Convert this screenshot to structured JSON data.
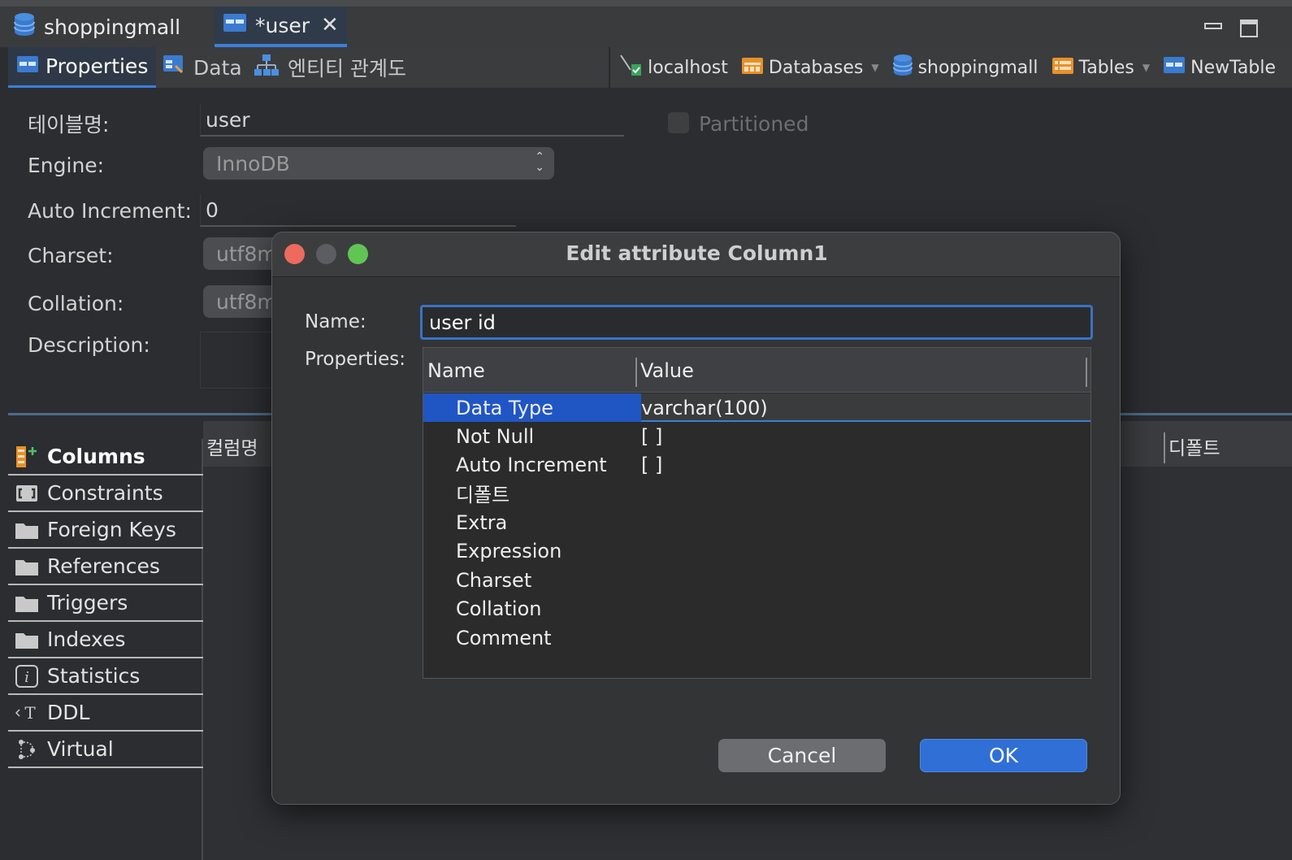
{
  "editor_tabs": [
    {
      "label": "shoppingmall",
      "icon": "database-icon"
    },
    {
      "label": "*user",
      "icon": "table-icon",
      "active": true
    }
  ],
  "sub_tabs": [
    {
      "label": "Properties",
      "icon": "table-icon",
      "active": true
    },
    {
      "label": "Data",
      "icon": "data-icon"
    },
    {
      "label": "엔티티 관계도",
      "icon": "diagram-icon"
    }
  ],
  "breadcrumbs": [
    {
      "label": "localhost",
      "icon": "connection-icon"
    },
    {
      "label": "Databases",
      "icon": "folder-icon",
      "dropdown": true
    },
    {
      "label": "shoppingmall",
      "icon": "database-icon"
    },
    {
      "label": "Tables",
      "icon": "folder-icon",
      "dropdown": true
    },
    {
      "label": "NewTable",
      "icon": "table-icon"
    }
  ],
  "form": {
    "table_name_label": "테이블명:",
    "table_name_value": "user",
    "partitioned_label": "Partitioned",
    "engine_label": "Engine:",
    "engine_value": "InnoDB",
    "auto_increment_label": "Auto Increment:",
    "auto_increment_value": "0",
    "charset_label": "Charset:",
    "charset_value": "utf8m",
    "collation_label": "Collation:",
    "collation_value": "utf8m",
    "description_label": "Description:"
  },
  "sections": [
    {
      "label": "Columns",
      "icon": "columns-icon",
      "active": true
    },
    {
      "label": "Constraints",
      "icon": "constraint-icon"
    },
    {
      "label": "Foreign Keys",
      "icon": "folder-icon"
    },
    {
      "label": "References",
      "icon": "folder-icon"
    },
    {
      "label": "Triggers",
      "icon": "folder-icon"
    },
    {
      "label": "Indexes",
      "icon": "folder-icon"
    },
    {
      "label": "Statistics",
      "icon": "info-icon"
    },
    {
      "label": "DDL",
      "icon": "ddl-icon"
    },
    {
      "label": "Virtual",
      "icon": "virtual-icon"
    }
  ],
  "columns_table": {
    "header_left": "컬럼명",
    "header_right": "디폴트"
  },
  "dialog": {
    "title": "Edit attribute Column1",
    "name_label": "Name:",
    "name_value": "user id",
    "properties_label": "Properties:",
    "table_headers": {
      "name": "Name",
      "value": "Value"
    },
    "properties": [
      {
        "name": "Data Type",
        "value": "varchar(100)",
        "selected": true
      },
      {
        "name": "Not Null",
        "value": "[ ]"
      },
      {
        "name": "Auto Increment",
        "value": "[ ]"
      },
      {
        "name": "디폴트",
        "value": ""
      },
      {
        "name": "Extra",
        "value": ""
      },
      {
        "name": "Expression",
        "value": ""
      },
      {
        "name": "Charset",
        "value": ""
      },
      {
        "name": "Collation",
        "value": ""
      },
      {
        "name": "Comment",
        "value": ""
      }
    ],
    "cancel_label": "Cancel",
    "ok_label": "OK"
  },
  "colors": {
    "accent": "#3b7fd6",
    "selection": "#2056c4",
    "close": "#ed6a5e",
    "minimize": "#5c5d60",
    "maximize": "#61c554"
  }
}
